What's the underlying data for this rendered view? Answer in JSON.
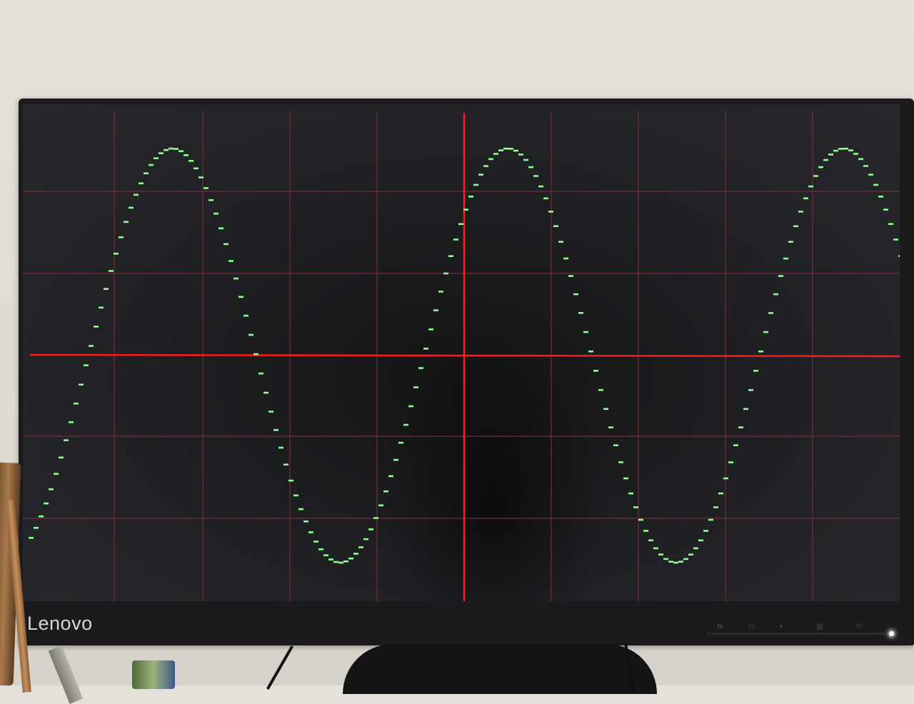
{
  "brand": {
    "logo_text": "Lenovo"
  },
  "monitor_controls": {
    "icons": [
      "input-icon",
      "menu-icon",
      "brightness-icon",
      "mode-icon",
      "power-icon"
    ]
  },
  "screen": {
    "background": "#1f2023",
    "grid_color": "#7a2a36",
    "axis_color": "#ff1a1a",
    "trace_color": "#8dff8d",
    "grid_divisions": {
      "x": 10,
      "y": 6
    }
  }
}
